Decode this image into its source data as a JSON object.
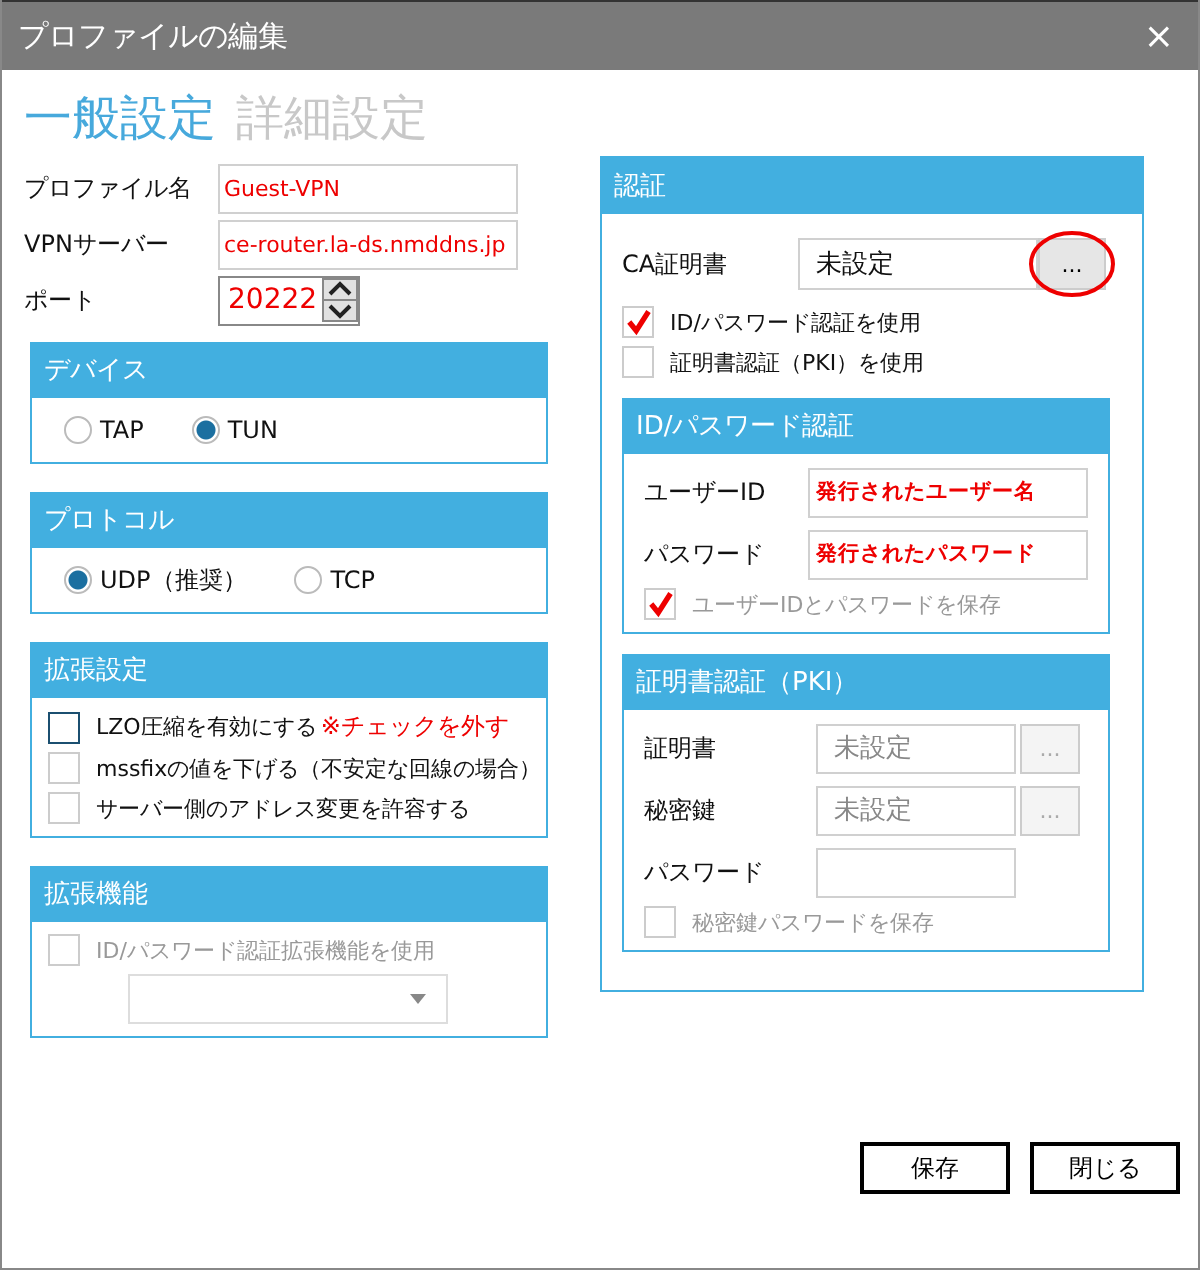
{
  "window": {
    "title": "プロファイルの編集",
    "close": "×"
  },
  "tabs": [
    {
      "label": "一般設定",
      "selected": true
    },
    {
      "label": "詳細設定",
      "selected": false
    }
  ],
  "fields": [
    {
      "label": "プロファイル名",
      "value": "Guest-VPN",
      "kind": "text"
    },
    {
      "label": "VPNサーバー",
      "value": "ce-router.la-ds.nmddns.jp",
      "kind": "text"
    },
    {
      "label": "ポート",
      "value": "20222",
      "kind": "spinner"
    }
  ],
  "device": {
    "title": "デバイス",
    "options": [
      {
        "label": "TAP",
        "selected": false
      },
      {
        "label": "TUN",
        "selected": true
      }
    ]
  },
  "protocol": {
    "title": "プロトコル",
    "options": [
      {
        "label": "UDP（推奨）",
        "selected": true
      },
      {
        "label": "TCP",
        "selected": false
      }
    ]
  },
  "extended_settings": {
    "title": "拡張設定",
    "items": [
      {
        "label": "LZO圧縮を有効にする",
        "checked": false,
        "focused": true,
        "note": "※チェックを外す"
      },
      {
        "label": "mssfixの値を下げる（不安定な回線の場合）",
        "checked": false,
        "focused": false
      },
      {
        "label": "サーバー側のアドレス変更を許容する",
        "checked": false,
        "focused": false
      }
    ]
  },
  "extended_features": {
    "title": "拡張機能",
    "items": [
      {
        "label": "ID/パスワード認証拡張機能を使用",
        "checked": false,
        "disabled": true
      }
    ]
  },
  "auth": {
    "title": "認証",
    "ca_cert": {
      "label": "CA証明書",
      "value": "未設定",
      "button": "...",
      "highlighted": true
    },
    "options": [
      {
        "label": "ID/パスワード認証を使用",
        "checked": true
      },
      {
        "label": "証明書認証（PKI）を使用",
        "checked": false
      }
    ],
    "id_password": {
      "title": "ID/パスワード認証",
      "fields": [
        {
          "label": "ユーザーID",
          "value": "発行されたユーザー名"
        },
        {
          "label": "パスワード",
          "value": "発行されたパスワード"
        }
      ],
      "save": {
        "label": "ユーザーIDとパスワードを保存",
        "checked": true,
        "disabled": true
      }
    },
    "pki": {
      "title": "証明書認証（PKI）",
      "fields": [
        {
          "label": "証明書",
          "value": "未設定",
          "button": "...",
          "disabled": true
        },
        {
          "label": "秘密鍵",
          "value": "未設定",
          "button": "...",
          "disabled": true
        },
        {
          "label": "パスワード"
        }
      ],
      "save": {
        "label": "秘密鍵パスワードを保存",
        "checked": false,
        "disabled": true
      }
    }
  },
  "buttons": [
    {
      "label": "保存"
    },
    {
      "label": "閉じる"
    }
  ]
}
